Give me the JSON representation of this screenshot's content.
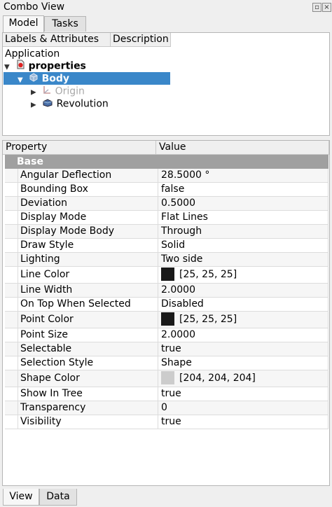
{
  "window": {
    "title": "Combo View"
  },
  "tabs": [
    {
      "label": "Model"
    },
    {
      "label": "Tasks"
    }
  ],
  "tree": {
    "columns": {
      "labels": "Labels & Attributes",
      "description": "Description"
    },
    "root": "Application",
    "items": [
      {
        "label": "properties",
        "icon": "document-icon"
      },
      {
        "label": "Body",
        "icon": "body-icon"
      },
      {
        "label": "Origin",
        "icon": "origin-icon"
      },
      {
        "label": "Revolution",
        "icon": "revolution-icon"
      }
    ]
  },
  "properties": {
    "columns": {
      "property": "Property",
      "value": "Value"
    },
    "group": "Base",
    "rows": [
      {
        "name": "Angular Deflection",
        "value": "28.5000 °"
      },
      {
        "name": "Bounding Box",
        "value": "false"
      },
      {
        "name": "Deviation",
        "value": "0.5000"
      },
      {
        "name": "Display Mode",
        "value": "Flat Lines"
      },
      {
        "name": "Display Mode Body",
        "value": "Through"
      },
      {
        "name": "Draw Style",
        "value": "Solid"
      },
      {
        "name": "Lighting",
        "value": "Two side"
      },
      {
        "name": "Line Color",
        "value": "[25, 25, 25]",
        "color": "#191919"
      },
      {
        "name": "Line Width",
        "value": "2.0000"
      },
      {
        "name": "On Top When Selected",
        "value": "Disabled"
      },
      {
        "name": "Point Color",
        "value": "[25, 25, 25]",
        "color": "#191919"
      },
      {
        "name": "Point Size",
        "value": "2.0000"
      },
      {
        "name": "Selectable",
        "value": "true"
      },
      {
        "name": "Selection Style",
        "value": "Shape"
      },
      {
        "name": "Shape Color",
        "value": "[204, 204, 204]",
        "color": "#cccccc"
      },
      {
        "name": "Show In Tree",
        "value": "true"
      },
      {
        "name": "Transparency",
        "value": "0"
      },
      {
        "name": "Visibility",
        "value": "true"
      }
    ]
  },
  "bottom_tabs": [
    {
      "label": "View"
    },
    {
      "label": "Data"
    }
  ],
  "colors": {
    "selection": "#3a87c9",
    "group_header": "#a0a0a0"
  }
}
